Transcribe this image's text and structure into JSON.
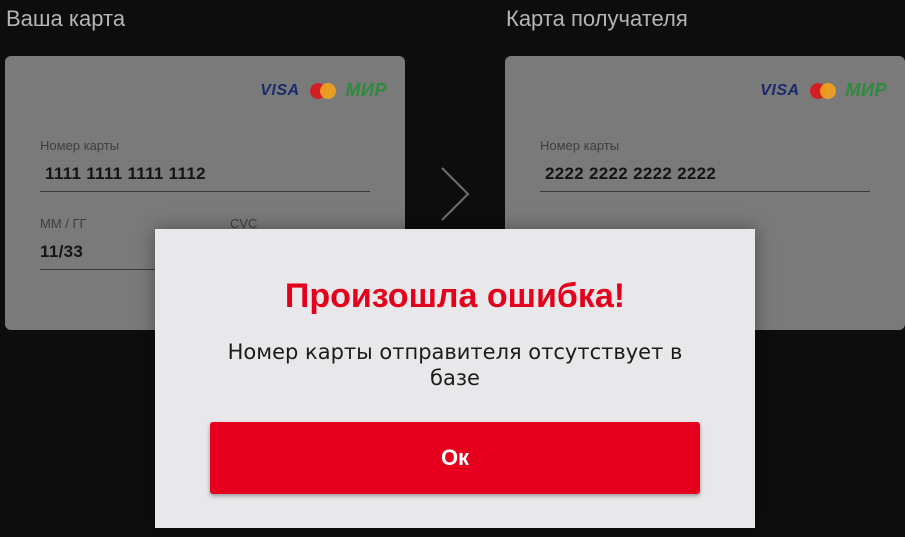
{
  "sender": {
    "title": "Ваша карта",
    "brands": {
      "visa": "VISA",
      "mir": "МИР",
      "mastercard_icon": "mastercard-icon"
    },
    "card_number_label": "Номер карты",
    "card_number": "1111 1111 1111 1112",
    "expiry_label": "ММ / ГГ",
    "expiry": "11/33",
    "cvc_label": "CVC"
  },
  "recipient": {
    "title": "Карта получателя",
    "brands": {
      "visa": "VISA",
      "mir": "МИР",
      "mastercard_icon": "mastercard-icon"
    },
    "card_number_label": "Номер карты",
    "card_number": "2222 2222 2222 2222"
  },
  "arrow_icon": "chevron-right-icon",
  "modal": {
    "title": "Произошла ошибка!",
    "message": "Номер карты отправителя отсутствует в базе",
    "ok_label": "Ок"
  },
  "colors": {
    "accent": "#e6001e",
    "page_bg": "#0d0d0d",
    "card_bg": "#7a7a7a",
    "modal_bg": "#e8e8ea"
  }
}
